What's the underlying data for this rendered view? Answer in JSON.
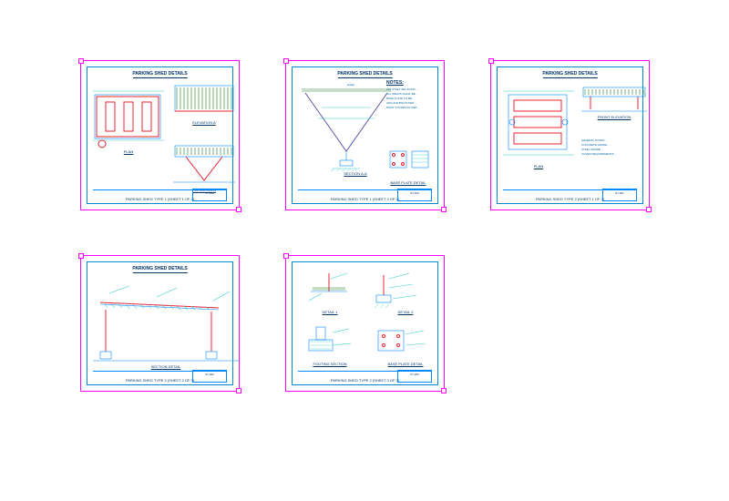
{
  "project_title": "PARKING SHED DETAILS",
  "sheets": [
    {
      "id": "s1",
      "title": "PARKING SHED DETAILS",
      "footer": "PARKING SHED TYPE 1 (SHEET 1 OF 2)",
      "tb": "ST-101",
      "views": {
        "plan": "PLAN",
        "elevA": "ELEVATION  A",
        "elevB": "ELEVATION  B"
      }
    },
    {
      "id": "s2",
      "title": "PARKING SHED DETAILS",
      "footer": "PARKING SHED TYPE 1 (SHEET 2 OF 2)",
      "tb": "ST-102",
      "views": {
        "section": "SECTION A-A",
        "base": "BASE PLATE DETAIL"
      },
      "notes_hd": "NOTES:",
      "notes": [
        "ALL STEEL SECTIONS ...",
        "ALL WELDS SHALL BE ...",
        "BASE PLATE TO BE ...",
        "ANCHOR BOLTS PER ...",
        "PAINT SYSTEM AS PER ..."
      ]
    },
    {
      "id": "s3",
      "title": "PARKING SHED DETAILS",
      "footer": "PARKING SHED TYPE 2 (SHEET 1 OF 3)",
      "tb": "ST-201",
      "views": {
        "plan": "PLAN",
        "front": "FRONT ELEVATION"
      },
      "notes": [
        "GENERAL NOTES ...",
        "CONCRETE GRADE ...",
        "STEEL GRADE ...",
        "COVER REQUIREMENTS ..."
      ]
    },
    {
      "id": "s4",
      "title": "PARKING SHED DETAILS",
      "footer": "PARKING SHED TYPE 2 (SHEET 2 OF 3)",
      "tb": "ST-202",
      "views": {
        "section": "SECTION DETAIL"
      }
    },
    {
      "id": "s5",
      "title": "",
      "footer": "PARKING SHED TYPE 2 (SHEET 3 OF 3)",
      "tb": "ST-203",
      "views": {
        "d1": "DETAIL 1",
        "d2": "DETAIL 2",
        "footing": "FOOTING SECTION",
        "base": "BASE PLATE DETAIL"
      }
    }
  ]
}
